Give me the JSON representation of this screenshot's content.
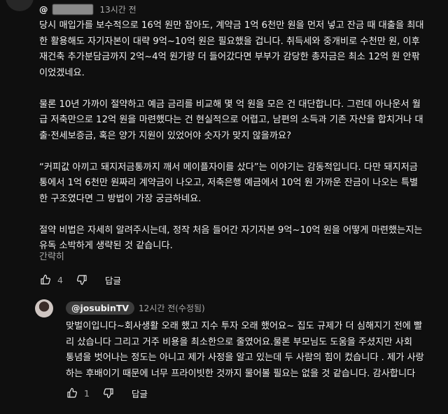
{
  "comment": {
    "handle_prefix": "@",
    "time": "13시간 전",
    "paragraphs": [
      "당시 매입가를 보수적으로 16억 원만 잡아도, 계약금 1억 6천만 원을 먼저 넣고 잔금 때 대출을 최대\n한 활용해도 자기자본이 대략 9억~10억 원은 필요했을 겁니다. 취득세와 중개비로 수천만 원, 이후\n재건축 추가분담금까지 2억~4억 원가량 더 들어갔다면 부부가 감당한 총자금은 최소 12억 원 안팎\n이었겠네요.",
      "물론 10년 가까이 절약하고 예금 금리를 비교해 몇 억 원을 모은 건 대단합니다. 그런데 아나운서 월\n급 저축만으로 12억 원을 마련했다는 건 현실적으로 어렵고, 남편의 소득과 기존 자산을 합치거나 대\n출·전세보증금, 혹은 양가 지원이 있었어야 숫자가 맞지 않을까요?",
      "“커피값 아끼고 돼지저금통까지 깨서 메이플자이를 샀다”는 이야기는 감동적입니다. 다만 돼지저금\n통에서 1억 6천만 원짜리 계약금이 나오고, 저축은행 예금에서 10억 원 가까운 잔금이 나오는 특별\n한 구조였다면 그 방법이 가장 궁금하네요.",
      "절약 비법은 자세히 알려주시는데, 정작 처음 들어간 자기자본 9억~10억 원을 어떻게 마련했는지는\n유독 소박하게 생략된 것 같습니다."
    ],
    "read_more": "간략히",
    "like_count": "4",
    "reply_label": "답글"
  },
  "reply": {
    "handle": "@josubinTV",
    "time": "12시간 전(수정됨)",
    "text": "맞벌이입니다~회사생활 오래 했고 지수 투자 오래 했어요~ 집도 규제가 더 심해지기 전에 빨\n리 샀습니다 그리고 거주 비용을 최소한으로 줄였어요.물론 부모님도 도움을 주셨지만 사회\n통념을 벗어나는 정도는 아니고 제가 사정을 알고 있는데 두 사람의 힘이 컸습니다 . 제가 사랑\n하는 후배이기 때문에 너무 프라이빗한 것까지 물어볼 필요는 없을 것 같습니다. 감사합니다",
    "like_count": "1",
    "reply_label": "답글"
  },
  "icons": {
    "like": "thumbs-up-icon",
    "dislike": "thumbs-down-icon"
  }
}
